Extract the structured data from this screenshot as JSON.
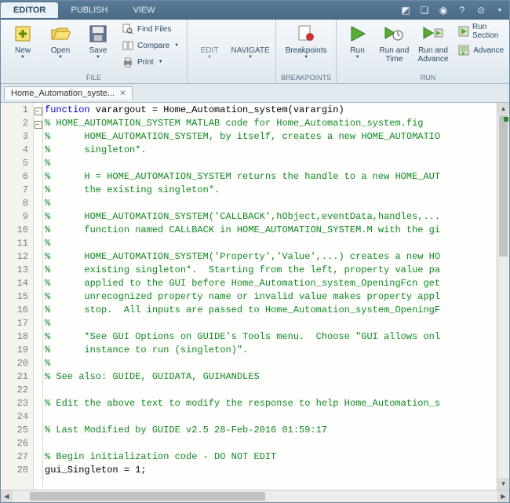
{
  "tabs": {
    "editor": "EDITOR",
    "publish": "PUBLISH",
    "view": "VIEW"
  },
  "ribbon": {
    "file": {
      "label": "FILE",
      "new": "New",
      "open": "Open",
      "save": "Save",
      "findfiles": "Find Files",
      "compare": "Compare",
      "print": "Print"
    },
    "edit": "EDIT",
    "navigate": "NAVIGATE",
    "breakpoints": {
      "label": "BREAKPOINTS",
      "btn": "Breakpoints"
    },
    "run": {
      "label": "RUN",
      "run": "Run",
      "runtime": "Run and\nTime",
      "runadv": "Run and\nAdvance",
      "runsection": "Run Section",
      "advance": "Advance"
    }
  },
  "file_tab": "Home_Automation_syste...",
  "lines": [
    {
      "n": 1,
      "fold": true,
      "html": "<span class='kw'>function</span> varargout = Home_Automation_system(varargin)"
    },
    {
      "n": 2,
      "fold": true,
      "html": "<span class='cm'>% HOME_AUTOMATION_SYSTEM MATLAB code for Home_Automation_system.fig</span>"
    },
    {
      "n": 3,
      "html": "<span class='cm'>%      HOME_AUTOMATION_SYSTEM, by itself, creates a new HOME_AUTOMATIO</span>"
    },
    {
      "n": 4,
      "html": "<span class='cm'>%      singleton*.</span>"
    },
    {
      "n": 5,
      "html": "<span class='cm'>%</span>"
    },
    {
      "n": 6,
      "html": "<span class='cm'>%      H = HOME_AUTOMATION_SYSTEM returns the handle to a new HOME_AUT</span>"
    },
    {
      "n": 7,
      "html": "<span class='cm'>%      the existing singleton*.</span>"
    },
    {
      "n": 8,
      "html": "<span class='cm'>%</span>"
    },
    {
      "n": 9,
      "html": "<span class='cm'>%      HOME_AUTOMATION_SYSTEM('CALLBACK',hObject,eventData,handles,...</span>"
    },
    {
      "n": 10,
      "html": "<span class='cm'>%      function named CALLBACK in HOME_AUTOMATION_SYSTEM.M with the gi</span>"
    },
    {
      "n": 11,
      "html": "<span class='cm'>%</span>"
    },
    {
      "n": 12,
      "html": "<span class='cm'>%      HOME_AUTOMATION_SYSTEM('Property','Value',...) creates a new HO</span>"
    },
    {
      "n": 13,
      "html": "<span class='cm'>%      existing singleton*.  Starting from the left, property value pa</span>"
    },
    {
      "n": 14,
      "html": "<span class='cm'>%      applied to the GUI before Home_Automation_system_OpeningFcn get</span>"
    },
    {
      "n": 15,
      "html": "<span class='cm'>%      unrecognized property name or invalid value makes property appl</span>"
    },
    {
      "n": 16,
      "html": "<span class='cm'>%      stop.  All inputs are passed to Home_Automation_system_OpeningF</span>"
    },
    {
      "n": 17,
      "html": "<span class='cm'>%</span>"
    },
    {
      "n": 18,
      "html": "<span class='cm'>%      *See GUI Options on GUIDE's Tools menu.  Choose \"GUI allows onl</span>"
    },
    {
      "n": 19,
      "html": "<span class='cm'>%      instance to run (singleton)\".</span>"
    },
    {
      "n": 20,
      "html": "<span class='cm'>%</span>"
    },
    {
      "n": 21,
      "html": "<span class='cm'>% See also: GUIDE, GUIDATA, GUIHANDLES</span>"
    },
    {
      "n": 22,
      "html": ""
    },
    {
      "n": 23,
      "html": "<span class='cm'>% Edit the above text to modify the response to help Home_Automation_s</span>"
    },
    {
      "n": 24,
      "html": ""
    },
    {
      "n": 25,
      "html": "<span class='cm'>% Last Modified by GUIDE v2.5 28-Feb-2016 01:59:17</span>"
    },
    {
      "n": 26,
      "html": ""
    },
    {
      "n": 27,
      "html": "<span class='cm'>% Begin initialization code - DO NOT EDIT</span>"
    },
    {
      "n": 28,
      "html": "gui_Singleton = 1;"
    }
  ]
}
